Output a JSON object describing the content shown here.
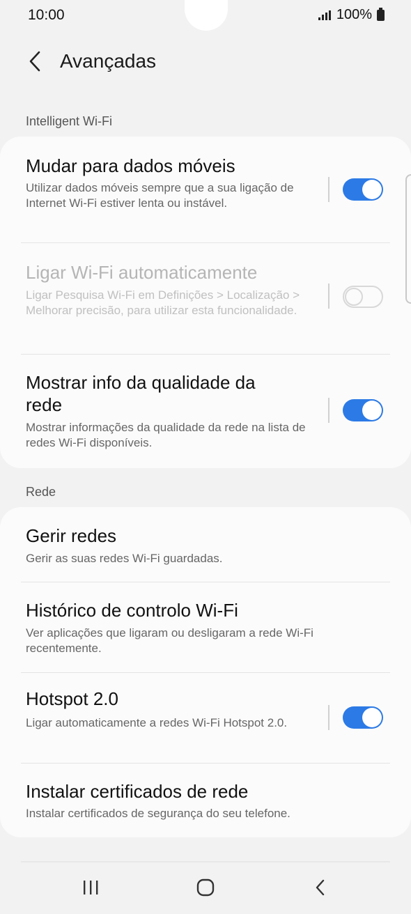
{
  "status": {
    "time": "10:00",
    "battery": "100%"
  },
  "header": {
    "title": "Avançadas"
  },
  "sections": {
    "intelligent": {
      "label": "Intelligent Wi-Fi"
    },
    "network": {
      "label": "Rede"
    }
  },
  "intelligent_rows": [
    {
      "title": "Mudar para dados móveis",
      "desc": "Utilizar dados móveis sempre que a sua ligação de Internet Wi-Fi estiver lenta ou instável.",
      "toggle": true
    },
    {
      "title": "Ligar Wi-Fi automaticamente",
      "desc": "Ligar Pesquisa Wi-Fi em Definições > Localização > Melhorar precisão, para utilizar esta funcionalidade.",
      "toggle": false,
      "disabled": true
    },
    {
      "title": "Mostrar info da qualidade da rede",
      "desc": "Mostrar informações da qualidade da rede na lista de redes Wi-Fi disponíveis.",
      "toggle": true
    }
  ],
  "network_rows": [
    {
      "title": "Gerir redes",
      "desc": "Gerir as suas redes Wi-Fi guardadas."
    },
    {
      "title": "Histórico de controlo Wi-Fi",
      "desc": "Ver aplicações que ligaram ou desligaram a rede Wi-Fi recentemente."
    },
    {
      "title": "Hotspot 2.0",
      "desc": "Ligar automaticamente a redes Wi-Fi Hotspot 2.0.",
      "toggle": true
    },
    {
      "title": "Instalar certificados de rede",
      "desc": "Instalar certificados de segurança do seu telefone."
    }
  ],
  "colors": {
    "accent": "#2c7ae6",
    "background": "#f2f2f2",
    "card": "#fbfbfb"
  },
  "icons": {
    "back": "chevron-left-icon",
    "recents": "recents-icon",
    "home": "home-icon",
    "nav_back": "nav-back-icon"
  }
}
